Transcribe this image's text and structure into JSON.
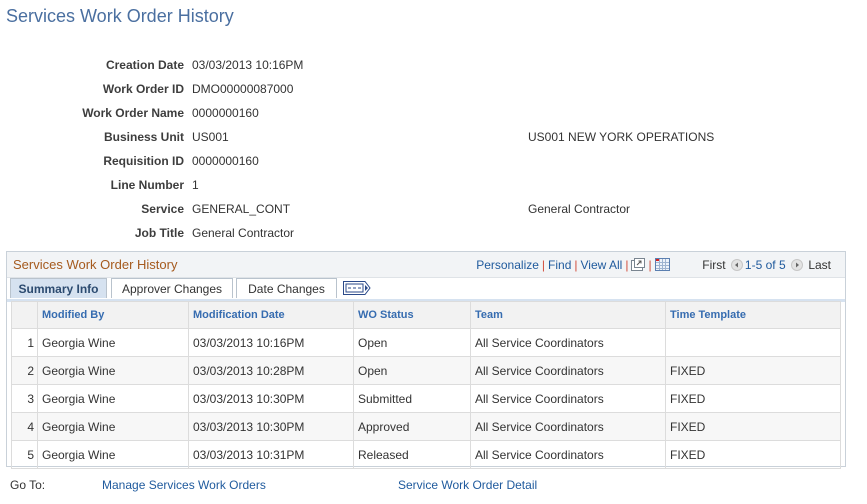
{
  "page": {
    "title": "Services Work Order History"
  },
  "fields": [
    {
      "label": "Creation Date",
      "value": "03/03/2013 10:16PM",
      "desc": ""
    },
    {
      "label": "Work Order ID",
      "value": "DMO00000087000",
      "desc": ""
    },
    {
      "label": "Work Order Name",
      "value": "0000000160",
      "desc": ""
    },
    {
      "label": "Business Unit",
      "value": "US001",
      "desc": "US001 NEW YORK OPERATIONS"
    },
    {
      "label": "Requisition ID",
      "value": "0000000160",
      "desc": ""
    },
    {
      "label": "Line Number",
      "value": "1",
      "desc": ""
    },
    {
      "label": "Service",
      "value": "GENERAL_CONT",
      "desc": "General Contractor"
    },
    {
      "label": "Job Title",
      "value": "General Contractor",
      "desc": ""
    }
  ],
  "grid": {
    "title": "Services Work Order History",
    "nav": {
      "personalize": "Personalize",
      "find": "Find",
      "view_all": "View All",
      "first": "First",
      "range": "1-5 of 5",
      "last": "Last",
      "icons": [
        "zoom-grid-icon",
        "download-spreadsheet-icon",
        "prev-icon",
        "next-icon"
      ]
    },
    "tabs": [
      {
        "label": "Summary Info",
        "active": true
      },
      {
        "label": "Approver Changes",
        "active": false
      },
      {
        "label": "Date Changes",
        "active": false
      }
    ],
    "columns": [
      "Modified By",
      "Modification Date",
      "WO Status",
      "Team",
      "Time Template"
    ],
    "rows": [
      {
        "num": "1",
        "modified_by": "Georgia Wine",
        "date": "03/03/2013 10:16PM",
        "status": "Open",
        "team": "All Service Coordinators",
        "template": ""
      },
      {
        "num": "2",
        "modified_by": "Georgia Wine",
        "date": "03/03/2013 10:28PM",
        "status": "Open",
        "team": "All Service Coordinators",
        "template": "FIXED"
      },
      {
        "num": "3",
        "modified_by": "Georgia Wine",
        "date": "03/03/2013 10:30PM",
        "status": "Submitted",
        "team": "All Service Coordinators",
        "template": "FIXED"
      },
      {
        "num": "4",
        "modified_by": "Georgia Wine",
        "date": "03/03/2013 10:30PM",
        "status": "Approved",
        "team": "All Service Coordinators",
        "template": "FIXED"
      },
      {
        "num": "5",
        "modified_by": "Georgia Wine",
        "date": "03/03/2013 10:31PM",
        "status": "Released",
        "team": "All Service Coordinators",
        "template": "FIXED"
      }
    ]
  },
  "goto": {
    "label": "Go To:",
    "links": [
      "Manage Services Work Orders",
      "Service Work Order Detail"
    ]
  }
}
